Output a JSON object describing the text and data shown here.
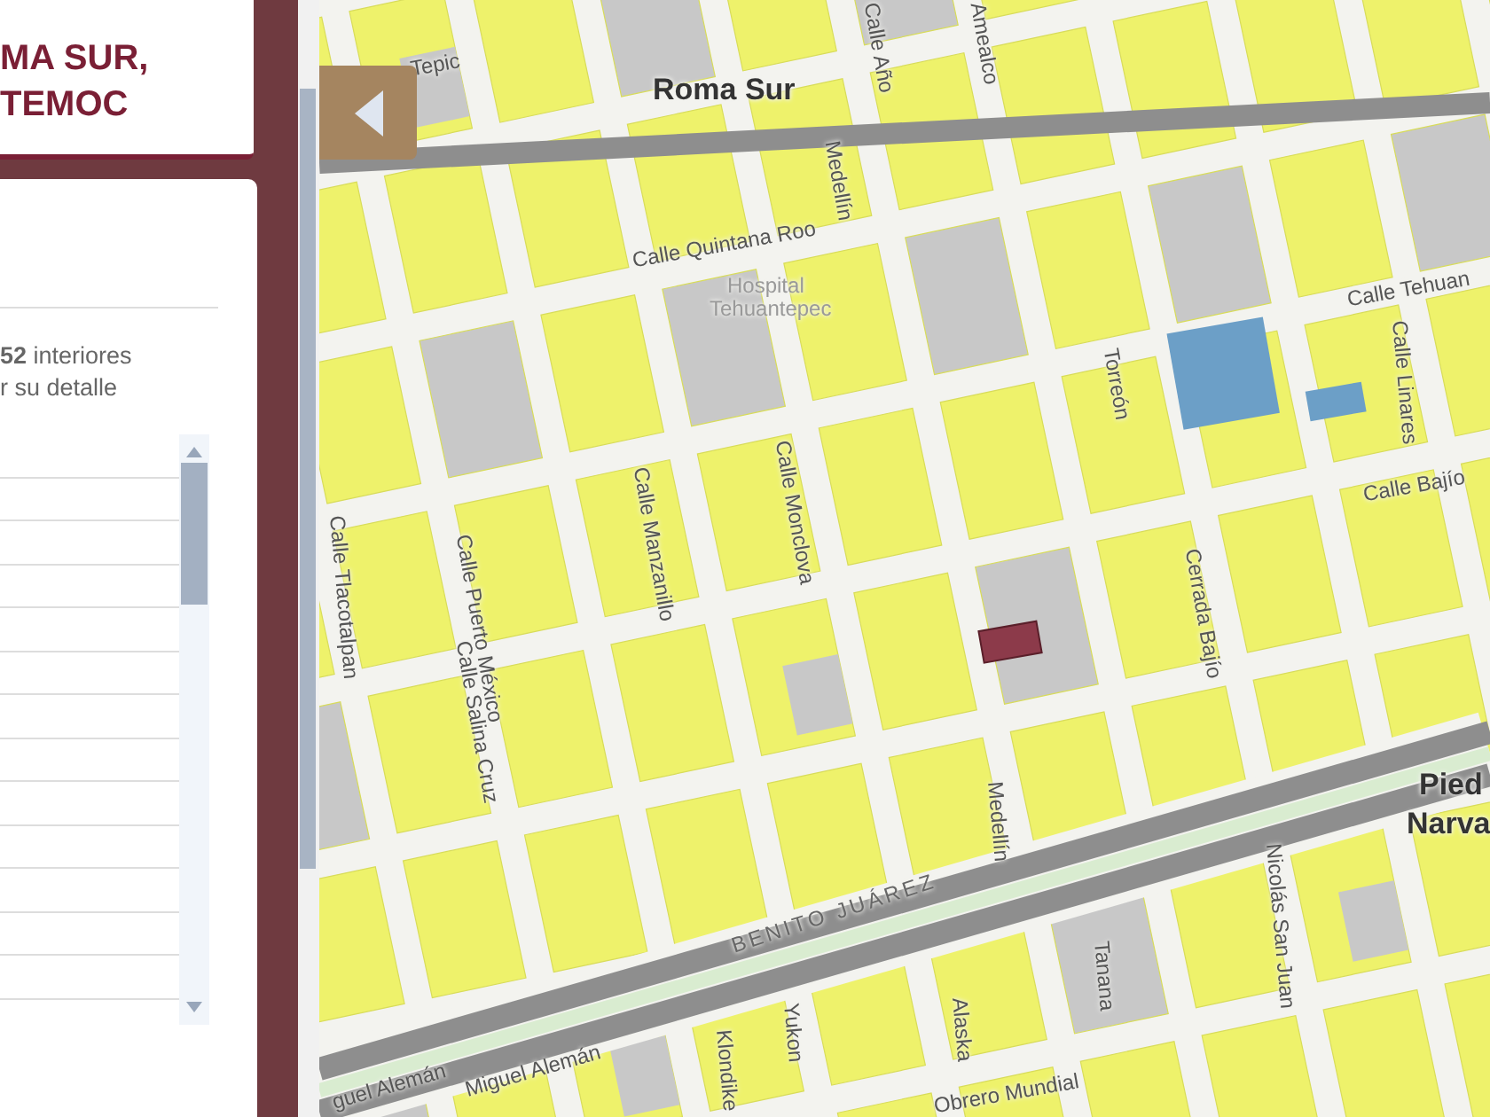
{
  "title_card": {
    "lines": [
      "MA SUR,",
      "TEMOC"
    ]
  },
  "panel": {
    "summary": [
      "**52** interiores",
      "r su detalle"
    ]
  },
  "map": {
    "labels": [
      {
        "text": "Tepic",
        "kind": "street"
      },
      {
        "text": "Roma Sur",
        "kind": "place"
      },
      {
        "text": "Calle Quintana Roo",
        "kind": "street"
      },
      {
        "text": "Medellín",
        "kind": "street"
      },
      {
        "text": "Calle Año",
        "kind": "street"
      },
      {
        "text": "Amealco",
        "kind": "street"
      },
      {
        "text": "Hospital",
        "kind": "poi"
      },
      {
        "text": "Tehuantepec",
        "kind": "poi"
      },
      {
        "text": "Calle Tehuan",
        "kind": "street"
      },
      {
        "text": "Calle Linares",
        "kind": "street"
      },
      {
        "text": "Torreón",
        "kind": "street"
      },
      {
        "text": "Calle Bajío",
        "kind": "street"
      },
      {
        "text": "Calle Monclova",
        "kind": "street"
      },
      {
        "text": "Calle Manzanillo",
        "kind": "street"
      },
      {
        "text": "Calle Tlacotalpan",
        "kind": "street"
      },
      {
        "text": "Calle Puerto México",
        "kind": "street"
      },
      {
        "text": "Calle Salina Cruz",
        "kind": "street"
      },
      {
        "text": "Cerrada Bajío",
        "kind": "street"
      },
      {
        "text": "Pied",
        "kind": "place"
      },
      {
        "text": "Narva",
        "kind": "place"
      },
      {
        "text": "Medellín",
        "kind": "street"
      },
      {
        "text": "BENITO JUÁREZ",
        "kind": "district"
      },
      {
        "text": "Nicolás San Juan",
        "kind": "street"
      },
      {
        "text": "Tanana",
        "kind": "street"
      },
      {
        "text": "Alaska",
        "kind": "street"
      },
      {
        "text": "Yukon",
        "kind": "street"
      },
      {
        "text": "Klondike",
        "kind": "street"
      },
      {
        "text": "guel Alemán",
        "kind": "street"
      },
      {
        "text": "Miguel Alemán",
        "kind": "street"
      },
      {
        "text": "Obrero Mundial",
        "kind": "street"
      }
    ]
  }
}
